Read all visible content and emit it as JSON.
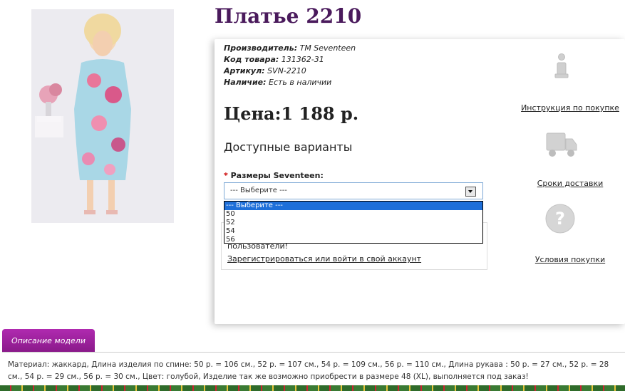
{
  "product": {
    "title": "Платье 2210",
    "specs": [
      {
        "label": "Производитель:",
        "value": "ТМ Seventeen"
      },
      {
        "label": "Код товара:",
        "value": "131362-31"
      },
      {
        "label": "Артикул:",
        "value": "SVN-2210"
      },
      {
        "label": "Наличие:",
        "value": "Есть в наличии"
      }
    ],
    "price": "Цена:1 188 р.",
    "variants_heading": "Доступные варианты",
    "size_required_mark": "*",
    "size_label": "Размеры Seventeen:",
    "size_selected": "--- Выберите ---",
    "size_options": [
      "--- Выберите ---",
      "50",
      "52",
      "54",
      "56"
    ]
  },
  "login_box": {
    "note": "пользователи!",
    "link": "Зарегистрироваться или войти в свой аккаунт"
  },
  "side": {
    "instruction": "Инструкция по покупке",
    "delivery": "Сроки доставки",
    "terms": "Условия покупки"
  },
  "tabs": {
    "description": "Описание модели"
  },
  "description": "Материал: жаккард, Длина изделия по спине: 50 р. = 106 см., 52 р. = 107 см., 54 р. = 109 см., 56 р. = 110 см., Длина рукава : 50 р. = 27 см., 52 р. = 28 см., 54 р. = 29 см., 56 р. = 30 см., Цвет: голубой, Изделие так же возможно приобрести в размере 48 (XL), выполняется под заказ!",
  "icons": {
    "info": "info-icon",
    "truck": "truck-icon",
    "question": "question-icon"
  },
  "colors": {
    "title": "#4a1a5c",
    "tab_bg": "#9b1f9b",
    "dropdown_selected": "#1e6fd9"
  }
}
